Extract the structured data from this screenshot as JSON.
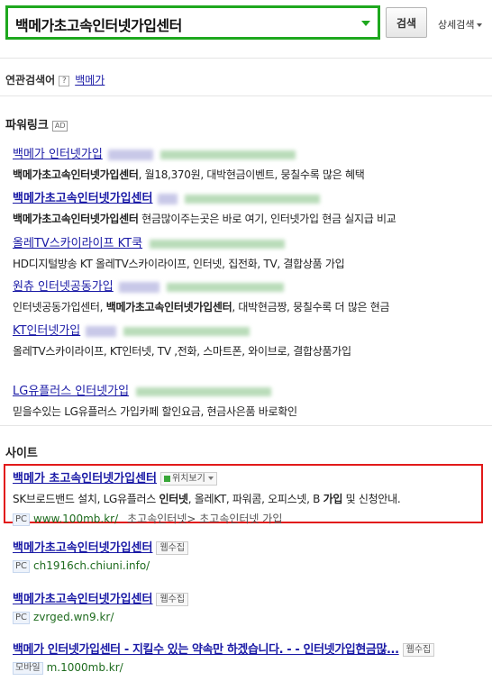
{
  "search": {
    "query": "백메가초고속인터넷가입센터",
    "button_label": "검색",
    "advanced_label": "상세검색"
  },
  "related": {
    "label": "연관검색어",
    "help": "?",
    "keyword": "백메가"
  },
  "powerlink": {
    "title": "파워링크",
    "badge": "AD",
    "items": [
      {
        "title": "백메가 인터넷가입",
        "desc_pre": "",
        "desc_bold": "백메가초고속인터넷가입센터",
        "desc_post": ", 월18,370원, 대박현금이벤트, 뭉칠수록 많은 혜택"
      },
      {
        "title": "백메가초고속인터넷가입센터",
        "desc_pre": "",
        "desc_bold": "백메가초고속인터넷가입센터",
        "desc_post": " 현금많이주는곳은 바로 여기, 인터넷가입 현금 실지급 비교"
      },
      {
        "title": "올레TV스카이라이프 KT쿡",
        "desc_pre": "HD디지털방송 KT 올레TV스카이라이프, 인터넷, 집전화, TV, 결합상품 가입",
        "desc_bold": "",
        "desc_post": ""
      },
      {
        "title": "원츄 인터넷공동가입",
        "desc_pre": "인터넷공동가입센터, ",
        "desc_bold": "백메가초고속인터넷가입센터",
        "desc_post": ", 대박현금짱, 뭉칠수록 더 많은 현금"
      },
      {
        "title": "KT인터넷가입",
        "desc_pre": "올레TV스카이라이프, KT인터넷, TV ,전화, 스마트폰, 와이브로, 결합상품가입",
        "desc_bold": "",
        "desc_post": ""
      },
      {
        "title": "LG유플러스 인터넷가입",
        "desc_pre": "믿을수있는 LG유플러스 가입카페 할인요금, 현금사은품 바로확인",
        "desc_bold": "",
        "desc_post": ""
      }
    ]
  },
  "sites": {
    "title": "사이트",
    "location_label": "위치보기",
    "webcollect_label": "웹수집",
    "items": [
      {
        "title": "백메가 초고속인터넷가입센터",
        "desc_pre": "SK브로드밴드 설치, LG유플러스 ",
        "desc_b1": "인터넷",
        "desc_mid": ", 올레KT, 파워콤, 오피스넷, B ",
        "desc_b2": "가입",
        "desc_post": " 및 신청안내.",
        "badge": "PC",
        "url": "www.100mb.kr/",
        "crumb": "초고속인터넷> 초고속인터넷 가입"
      },
      {
        "title": "백메가초고속인터넷가입센터",
        "badge": "PC",
        "url": "ch1916ch.chiuni.info/"
      },
      {
        "title": "백메가초고속인터넷가입센터",
        "badge": "PC",
        "url": "zvrged.wn9.kr/"
      },
      {
        "title": "백메가 인터넷가입센터 - 지킬수 있는 약속만 하겠습니다. - - 인터넷가입현금많...",
        "badge": "모바일",
        "url": "m.1000mb.kr/"
      }
    ]
  },
  "colors": {
    "accent_green": "#1ea81e",
    "link_blue": "#1a1aa6",
    "highlight_red": "#e21a1a",
    "url_green": "#1e6b1e"
  }
}
